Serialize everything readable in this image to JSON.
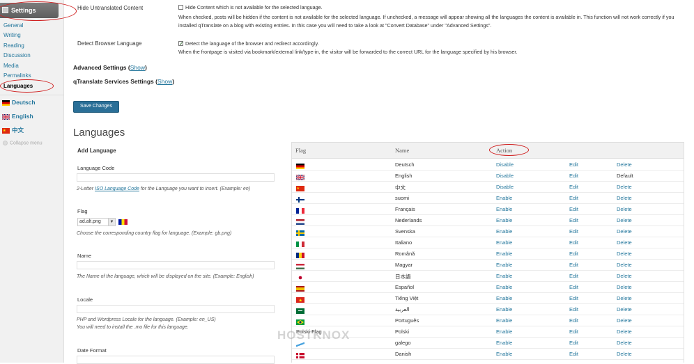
{
  "sidebar": {
    "heading": "Settings",
    "submenu": [
      "General",
      "Writing",
      "Reading",
      "Discussion",
      "Media",
      "Permalinks",
      "Languages"
    ],
    "active": "Languages",
    "languages": [
      {
        "label": "Deutsch",
        "flag": "de"
      },
      {
        "label": "English",
        "flag": "gb"
      },
      {
        "label": "中文",
        "flag": "cn"
      }
    ],
    "collapse_label": "Collapse menu"
  },
  "hide_content": {
    "label": "Hide Untranslated Content",
    "checkbox_label": "Hide Content which is not available for the selected language.",
    "description": "When checked, posts will be hidden if the content is not available for the selected language. If unchecked, a message will appear showing all the languages the content is available in. This function will not work correctly if you installed qTranslate on a blog with existing entries. In this case you will need to take a look at \"Convert Database\" under \"Advanced Settings\".",
    "checked": false
  },
  "detect_lang": {
    "label": "Detect Browser Language",
    "checkbox_label": "Detect the language of the browser and redirect accordingly.",
    "description": "When the frontpage is visited via bookmark/external link/type-in, the visitor will be forwarded to the correct URL for the language specified by his browser.",
    "checked": true
  },
  "advanced": {
    "title": "Advanced Settings",
    "link": "Show"
  },
  "services": {
    "title": "qTranslate Services Settings",
    "link": "Show"
  },
  "save_button": "Save Changes",
  "languages_title": "Languages",
  "add_language": {
    "title": "Add Language",
    "code_label": "Language Code",
    "code_hint_pre": "2-Letter ",
    "code_hint_link": "ISO Language Code",
    "code_hint_post": " for the Language you want to insert. (Example: en)",
    "flag_label": "Flag",
    "flag_value": "ad.alt.png",
    "flag_hint": "Choose the corresponding country flag for language. (Example: gb.png)",
    "name_label": "Name",
    "name_hint": "The Name of the language, which will be displayed on the site. (Example: English)",
    "locale_label": "Locale",
    "locale_hint1": "PHP and Wordpress Locale for the language. (Example: en_US)",
    "locale_hint2": "You will need to install the .mo file for this language.",
    "date_label": "Date Format"
  },
  "table": {
    "headers": {
      "flag": "Flag",
      "name": "Name",
      "action": "Action"
    },
    "rows": [
      {
        "flag": "de",
        "name": "Deutsch",
        "action": "Disable",
        "edit": "Edit",
        "del": "Delete"
      },
      {
        "flag": "gb",
        "name": "English",
        "action": "Disable",
        "edit": "Edit",
        "del": "Default"
      },
      {
        "flag": "cn",
        "name": "中文",
        "action": "Disable",
        "edit": "Edit",
        "del": "Delete"
      },
      {
        "flag": "fi",
        "name": "suomi",
        "action": "Enable",
        "edit": "Edit",
        "del": "Delete"
      },
      {
        "flag": "fr",
        "name": "Français",
        "action": "Enable",
        "edit": "Edit",
        "del": "Delete"
      },
      {
        "flag": "nl",
        "name": "Nederlands",
        "action": "Enable",
        "edit": "Edit",
        "del": "Delete"
      },
      {
        "flag": "se",
        "name": "Svenska",
        "action": "Enable",
        "edit": "Edit",
        "del": "Delete"
      },
      {
        "flag": "it",
        "name": "Italiano",
        "action": "Enable",
        "edit": "Edit",
        "del": "Delete"
      },
      {
        "flag": "ro",
        "name": "Română",
        "action": "Enable",
        "edit": "Edit",
        "del": "Delete"
      },
      {
        "flag": "hu",
        "name": "Magyar",
        "action": "Enable",
        "edit": "Edit",
        "del": "Delete"
      },
      {
        "flag": "jp",
        "name": "日本語",
        "action": "Enable",
        "edit": "Edit",
        "del": "Delete"
      },
      {
        "flag": "es",
        "name": "Español",
        "action": "Enable",
        "edit": "Edit",
        "del": "Delete"
      },
      {
        "flag": "vn",
        "name": "Tiếng Việt",
        "action": "Enable",
        "edit": "Edit",
        "del": "Delete"
      },
      {
        "flag": "sa",
        "name": "العربية",
        "action": "Enable",
        "edit": "Edit",
        "del": "Delete"
      },
      {
        "flag": "br",
        "name": "Português",
        "action": "Enable",
        "edit": "Edit",
        "del": "Delete"
      },
      {
        "flag": "text",
        "flag_text": "Polski Flag",
        "name": "Polski",
        "action": "Enable",
        "edit": "Edit",
        "del": "Delete"
      },
      {
        "flag": "gl",
        "name": "galego",
        "action": "Enable",
        "edit": "Edit",
        "del": "Delete"
      },
      {
        "flag": "dk",
        "name": "Danish",
        "action": "Enable",
        "edit": "Edit",
        "del": "Delete"
      }
    ]
  },
  "watermark": "HOSTKNOX",
  "colors": {
    "link": "#21759b",
    "annotation": "#d02020",
    "button": "#2a6f97"
  }
}
